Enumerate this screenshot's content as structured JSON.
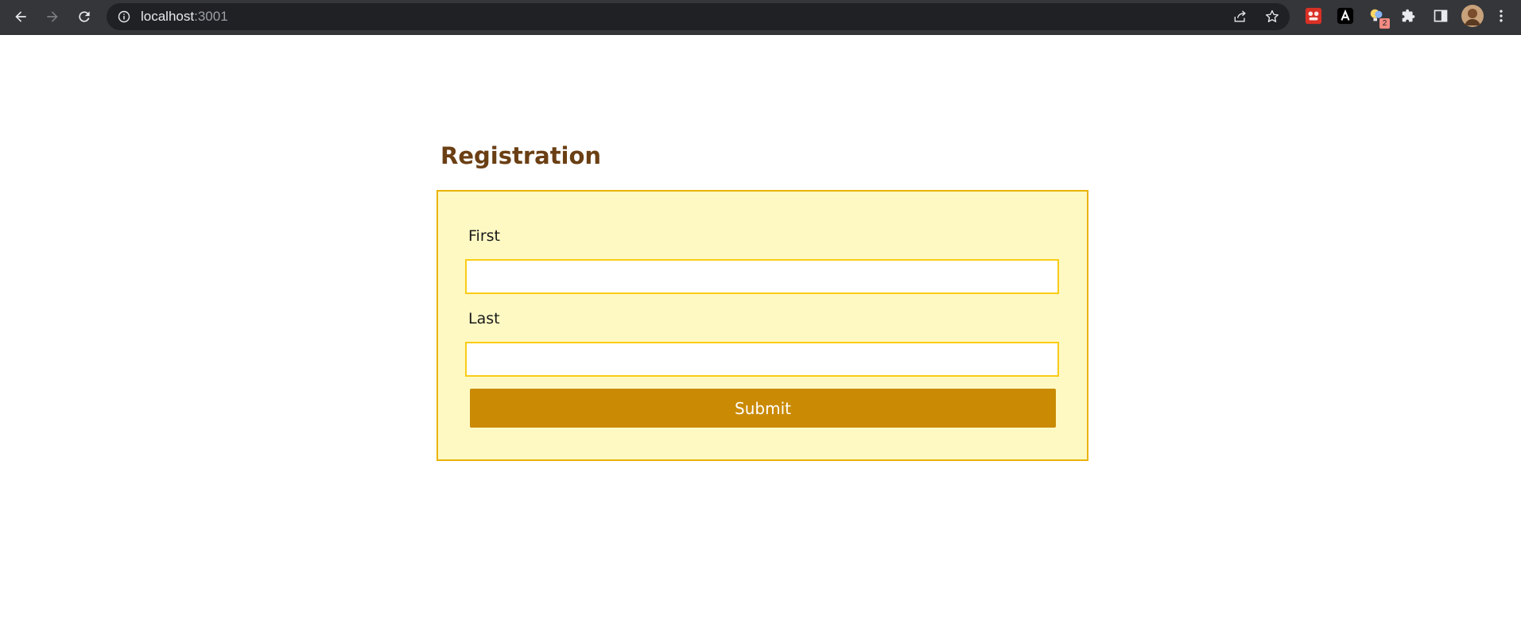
{
  "browser": {
    "url_host": "localhost",
    "url_port": ":3001",
    "extension_badge_count": "2",
    "icons": {
      "back": "arrow-left-icon",
      "forward": "arrow-right-icon",
      "reload": "reload-icon",
      "info": "info-icon",
      "share": "share-icon",
      "bookmark": "star-icon",
      "extensions": "puzzle-icon",
      "side_panel": "side-panel-icon",
      "menu": "kebab-menu-icon"
    }
  },
  "page": {
    "title": "Registration",
    "form": {
      "first_label": "First",
      "first_value": "",
      "last_label": "Last",
      "last_value": "",
      "submit_label": "Submit"
    }
  },
  "colors": {
    "title": "#6b3f14",
    "card_bg": "#fef9c3",
    "card_border": "#eab308",
    "input_border": "#facc15",
    "button_bg": "#ca8a04",
    "chrome_bg": "#35363a"
  }
}
